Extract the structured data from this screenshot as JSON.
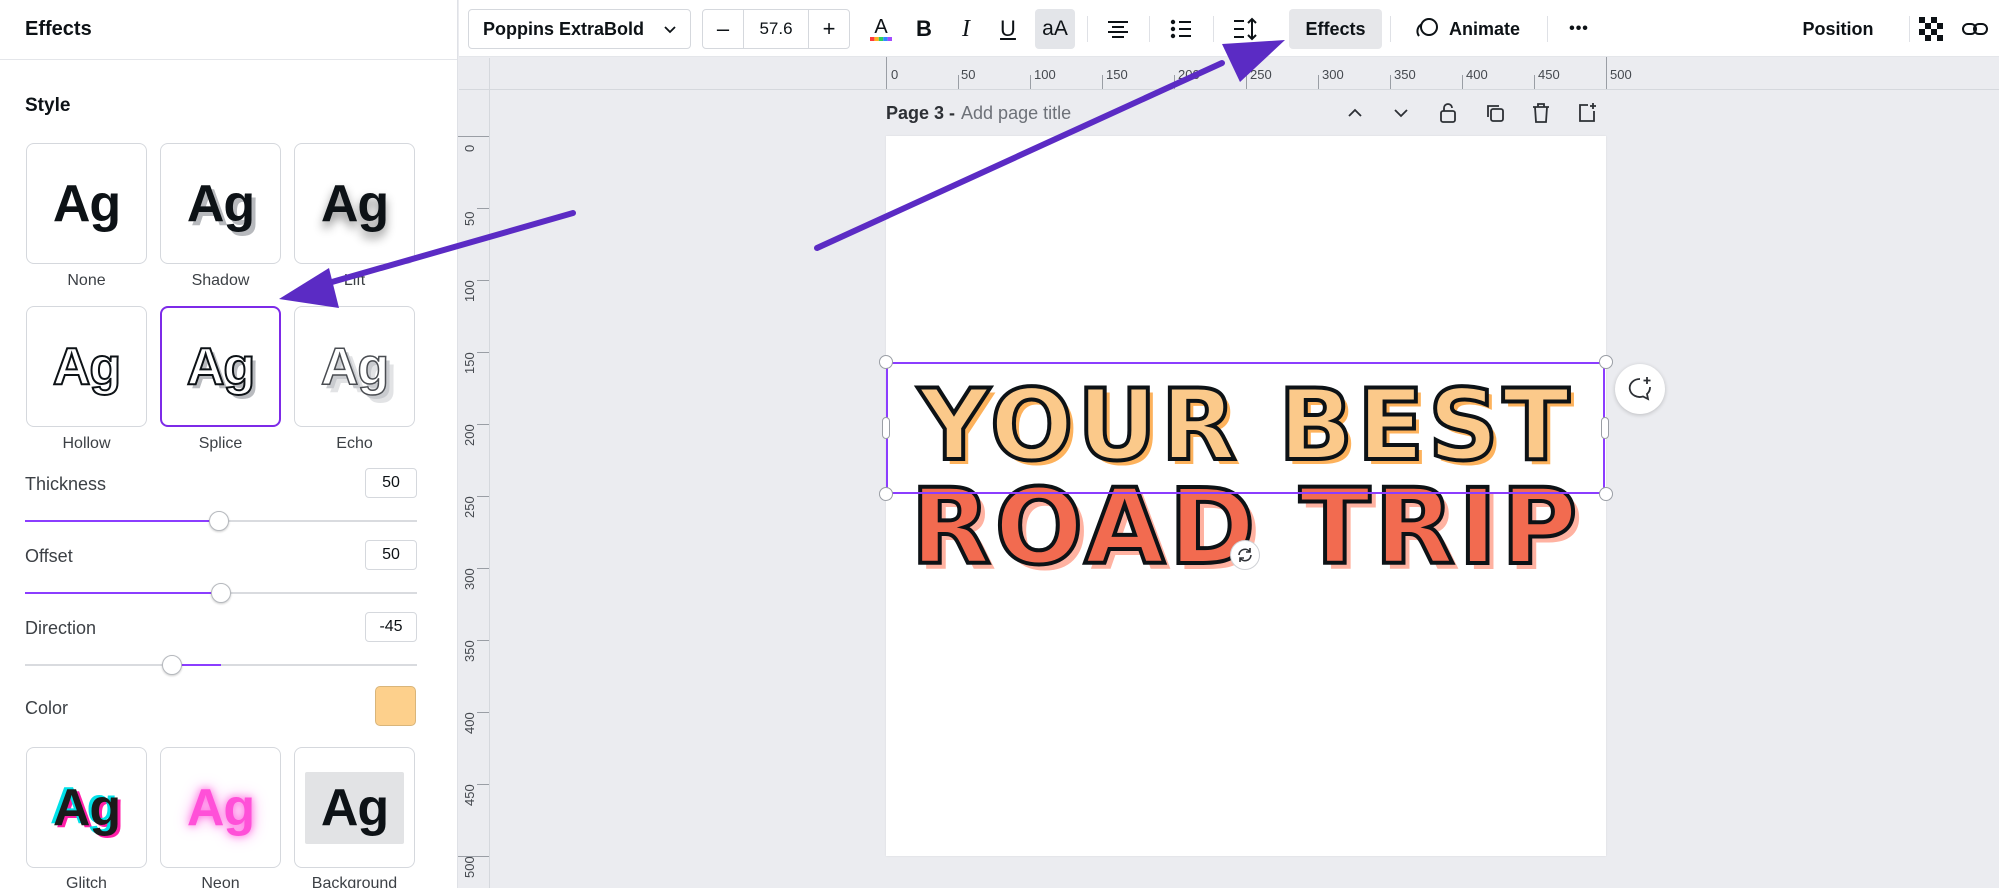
{
  "panel": {
    "title": "Effects",
    "style_heading": "Style",
    "styles": [
      {
        "label": "None",
        "sample": "Ag"
      },
      {
        "label": "Shadow",
        "sample": "Ag"
      },
      {
        "label": "Lift",
        "sample": "Ag"
      },
      {
        "label": "Hollow",
        "sample": "Ag"
      },
      {
        "label": "Splice",
        "sample": "Ag",
        "selected": true
      },
      {
        "label": "Echo",
        "sample": "Ag"
      },
      {
        "label": "Glitch",
        "sample": "Ag"
      },
      {
        "label": "Neon",
        "sample": "Ag"
      },
      {
        "label": "Background",
        "sample": "Ag"
      }
    ],
    "sliders": [
      {
        "label": "Thickness",
        "value": "50",
        "range": [
          0,
          100
        ]
      },
      {
        "label": "Offset",
        "value": "50",
        "range": [
          0,
          100
        ]
      },
      {
        "label": "Direction",
        "value": "-45",
        "range": [
          -180,
          180
        ]
      }
    ],
    "color_label": "Color",
    "color_value": "#fdd08c"
  },
  "toolbar": {
    "font": "Poppins ExtraBold",
    "font_size": "57.6",
    "minus": "–",
    "plus": "+",
    "bold": "B",
    "italic": "I",
    "underline": "U",
    "case": "aA",
    "effects": "Effects",
    "animate": "Animate",
    "more": "•••",
    "position": "Position"
  },
  "ruler": {
    "top_labels": [
      "0",
      "50",
      "100",
      "150",
      "200",
      "250",
      "300",
      "350",
      "400",
      "450",
      "500"
    ],
    "left_labels": [
      "0",
      "50",
      "100",
      "150",
      "200",
      "250",
      "300",
      "350",
      "400",
      "450",
      "500"
    ]
  },
  "page": {
    "number": "Page 3 -",
    "title_placeholder": "Add page title",
    "headline_line1": "YOUR BEST",
    "headline_line2": "ROAD TRIP"
  },
  "colors": {
    "accent": "#8b3dff",
    "annotation_arrow": "#5b2bc4",
    "headline_line1_fill": "#fbc98a",
    "headline_line2_fill": "#f26b50"
  }
}
